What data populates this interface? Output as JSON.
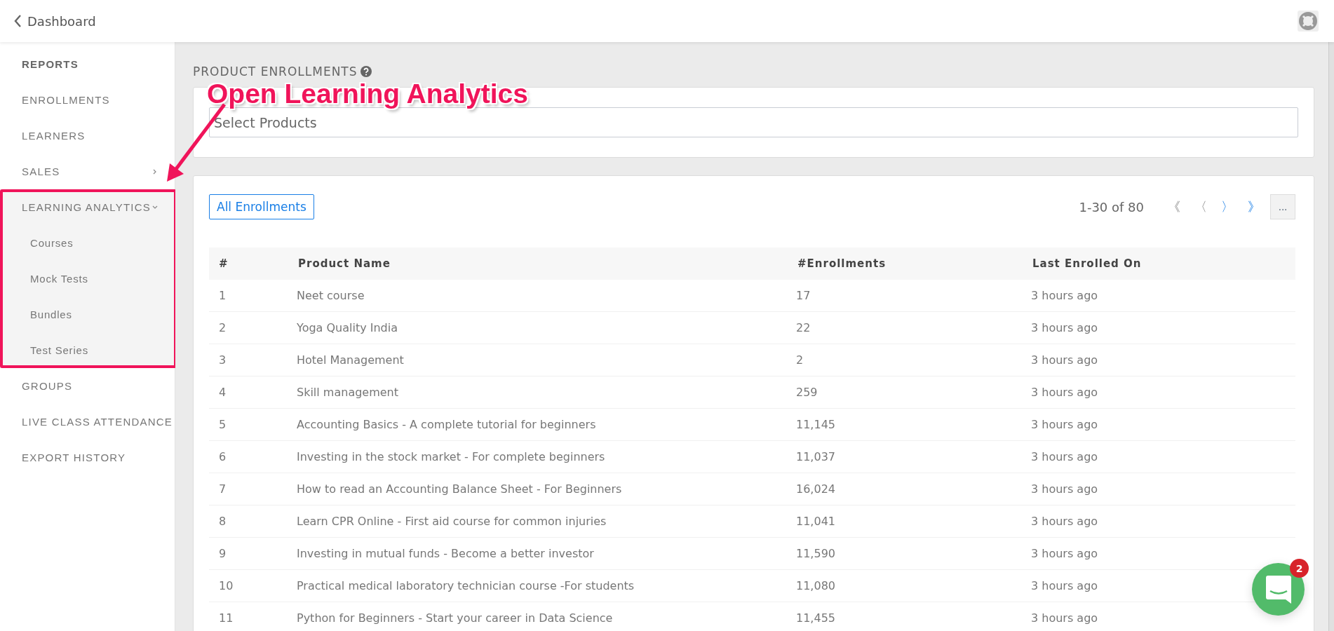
{
  "header": {
    "back_label": "Dashboard"
  },
  "sidebar": {
    "items": [
      {
        "label": "REPORTS",
        "kind": "heading"
      },
      {
        "label": "ENROLLMENTS",
        "kind": "link"
      },
      {
        "label": "LEARNERS",
        "kind": "link"
      },
      {
        "label": "SALES",
        "kind": "collapsible",
        "expanded": false
      },
      {
        "label": "LEARNING ANALYTICS",
        "kind": "collapsible",
        "expanded": true,
        "children": [
          {
            "label": "Courses"
          },
          {
            "label": "Mock Tests"
          },
          {
            "label": "Bundles"
          },
          {
            "label": "Test Series"
          }
        ]
      },
      {
        "label": "GROUPS",
        "kind": "link"
      },
      {
        "label": "LIVE CLASS ATTENDANCE",
        "kind": "link"
      },
      {
        "label": "EXPORT HISTORY",
        "kind": "link"
      }
    ]
  },
  "page_title": "PRODUCT ENROLLMENTS",
  "product_select": {
    "placeholder": "Select Products"
  },
  "filter_button": "All Enrollments",
  "pagination": {
    "range": "1-30 of 80",
    "buttons": [
      {
        "label": "《",
        "disabled": true
      },
      {
        "label": "〈",
        "disabled": true
      },
      {
        "label": "〉",
        "disabled": false
      },
      {
        "label": "》",
        "disabled": false
      }
    ],
    "more": "..."
  },
  "table": {
    "columns": [
      "#",
      "Product Name",
      "#Enrollments",
      "Last Enrolled On"
    ],
    "rows": [
      [
        "1",
        "Neet course",
        "17",
        "3 hours ago"
      ],
      [
        "2",
        "Yoga Quality India",
        "22",
        "3 hours ago"
      ],
      [
        "3",
        "Hotel Management",
        "2",
        "3 hours ago"
      ],
      [
        "4",
        "Skill management",
        "259",
        "3 hours ago"
      ],
      [
        "5",
        "Accounting Basics - A complete tutorial for beginners",
        "11,145",
        "3 hours ago"
      ],
      [
        "6",
        "Investing in the stock market - For complete beginners",
        "11,037",
        "3 hours ago"
      ],
      [
        "7",
        "How to read an Accounting Balance Sheet - For Beginners",
        "16,024",
        "3 hours ago"
      ],
      [
        "8",
        "Learn CPR Online - First aid course for common injuries",
        "11,041",
        "3 hours ago"
      ],
      [
        "9",
        "Investing in mutual funds - Become a better investor",
        "11,590",
        "3 hours ago"
      ],
      [
        "10",
        "Practical medical laboratory technician course -For students",
        "11,080",
        "3 hours ago"
      ],
      [
        "11",
        "Python for Beginners - Start your career in Data Science",
        "11,455",
        "3 hours ago"
      ]
    ]
  },
  "chat": {
    "badge": "2"
  },
  "annotation": {
    "text": "Open Learning Analytics"
  }
}
